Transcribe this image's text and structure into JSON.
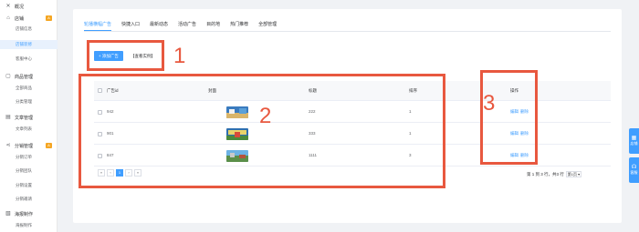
{
  "sidebar": {
    "groups": [
      {
        "label": "概况",
        "icon": "close-cross-icon",
        "badge": ""
      },
      {
        "label": "店铺",
        "icon": "home-icon",
        "badge": "A"
      },
      {
        "label": "商品管理",
        "icon": "box-icon",
        "badge": ""
      },
      {
        "label": "文章管理",
        "icon": "document-icon",
        "badge": ""
      },
      {
        "label": "分销管理",
        "icon": "share-icon",
        "badge": "A"
      },
      {
        "label": "海报制作",
        "icon": "image-icon",
        "badge": ""
      }
    ],
    "items": [
      {
        "label": "店铺信息"
      },
      {
        "label": "店铺装修"
      },
      {
        "label": "客服中心"
      },
      {
        "label": "全部商品"
      },
      {
        "label": "分类管理"
      },
      {
        "label": "文章列表"
      },
      {
        "label": "分销订单"
      },
      {
        "label": "分销团队"
      },
      {
        "label": "分销设置"
      },
      {
        "label": "分销邀请"
      },
      {
        "label": "海报制作"
      }
    ]
  },
  "tabs": [
    "轮播横幅广告",
    "快捷入口",
    "最新动态",
    "活动广告",
    "目的地",
    "热门推荐",
    "全部管理"
  ],
  "toolbar": {
    "add_label": "+ 添加广告",
    "example_label": "【查看实例】"
  },
  "table": {
    "headers": {
      "id": "广告id",
      "cover": "封面",
      "title": "标题",
      "sort": "排序",
      "op": "操作"
    },
    "rows": [
      {
        "id": "942",
        "title": "222",
        "sort": "1",
        "edit": "编辑",
        "del": "删除"
      },
      {
        "id": "901",
        "title": "333",
        "sort": "1",
        "edit": "编辑",
        "del": "删除"
      },
      {
        "id": "847",
        "title": "1111",
        "sort": "3",
        "edit": "编辑",
        "del": "删除"
      }
    ]
  },
  "pager": {
    "first": "«",
    "prev": "‹",
    "page": "1",
    "next": "›",
    "last": "»",
    "info": "第 1 到 3 行，共3 行",
    "size": "第1页 ▾"
  },
  "annotations": {
    "n1": "1",
    "n2": "2",
    "n3": "3",
    "color": "#e8583f"
  },
  "float_tabs": [
    {
      "label": "店铺"
    },
    {
      "label": "客服"
    }
  ],
  "colors": {
    "primary": "#409eff",
    "accent": "#e8583f",
    "badge": "#f5a623"
  }
}
